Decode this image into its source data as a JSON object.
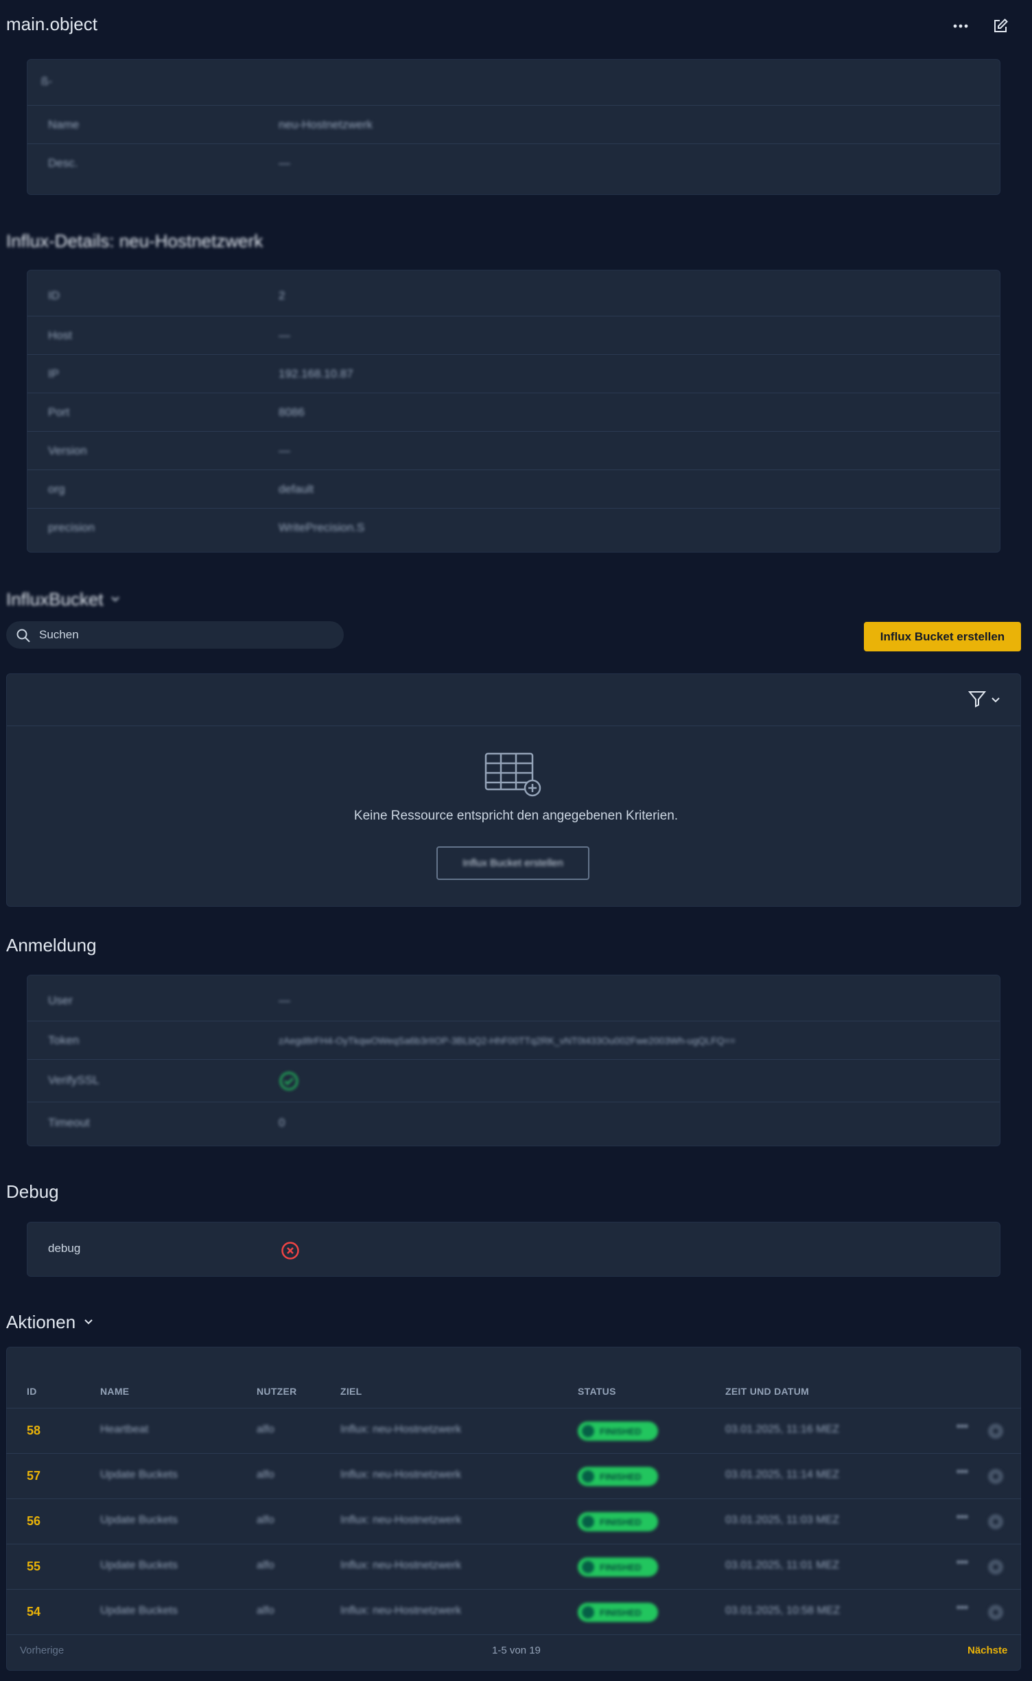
{
  "header": {
    "title": "main.object"
  },
  "info": {
    "title": "ß-",
    "rows": [
      {
        "label": "Name",
        "value": "neu-Hostnetzwerk"
      },
      {
        "label": "Desc.",
        "value": "—"
      }
    ]
  },
  "details": {
    "heading": "Influx-Details: neu-Hostnetzwerk",
    "rows": [
      {
        "label": "ID",
        "value": "2"
      },
      {
        "label": "Host",
        "value": "—"
      },
      {
        "label": "IP",
        "value": "192.168.10.87"
      },
      {
        "label": "Port",
        "value": "8086"
      },
      {
        "label": "Version",
        "value": "—"
      },
      {
        "label": "org",
        "value": "default"
      },
      {
        "label": "precision",
        "value": "WritePrecision.S"
      }
    ]
  },
  "buckets": {
    "heading": "InfluxBucket",
    "search_placeholder": "Suchen",
    "create_label": "Influx Bucket erstellen",
    "empty_text": "Keine Ressource entspricht den angegebenen Kriterien.",
    "empty_button": "Influx Bucket erstellen"
  },
  "login": {
    "heading": "Anmeldung",
    "rows": [
      {
        "label": "User",
        "value": "—"
      },
      {
        "label": "Token",
        "value": "zAegd8rFH4-OyTkqwOWeqSa6b3rIIOP-3BLbQ2-HhF00TTq2RK_vNT0t433Ou002Fwe2003Wh-ugQLFQ=="
      },
      {
        "label": "VerifySSL",
        "value": ""
      },
      {
        "label": "Timeout",
        "value": "0"
      }
    ]
  },
  "debug": {
    "heading": "Debug",
    "label": "debug"
  },
  "actions": {
    "heading": "Aktionen",
    "columns": [
      "ID",
      "NAME",
      "NUTZER",
      "ZIEL",
      "STATUS",
      "ZEIT UND DATUM"
    ],
    "rows": [
      {
        "id": "58",
        "name": "Heartbeat",
        "user": "alfo",
        "target": "Influx: neu-Hostnetzwerk",
        "status": "FINISHED",
        "time": "03.01.2025, 11:16 MEZ"
      },
      {
        "id": "57",
        "name": "Update Buckets",
        "user": "alfo",
        "target": "Influx: neu-Hostnetzwerk",
        "status": "FINISHED",
        "time": "03.01.2025, 11:14 MEZ"
      },
      {
        "id": "56",
        "name": "Update Buckets",
        "user": "alfo",
        "target": "Influx: neu-Hostnetzwerk",
        "status": "FINISHED",
        "time": "03.01.2025, 11:03 MEZ"
      },
      {
        "id": "55",
        "name": "Update Buckets",
        "user": "alfo",
        "target": "Influx: neu-Hostnetzwerk",
        "status": "FINISHED",
        "time": "03.01.2025, 11:01 MEZ"
      },
      {
        "id": "54",
        "name": "Update Buckets",
        "user": "alfo",
        "target": "Influx: neu-Hostnetzwerk",
        "status": "FINISHED",
        "time": "03.01.2025, 10:58 MEZ"
      }
    ],
    "pager": {
      "prev": "Vorherige",
      "range": "1-5 von 19",
      "next": "Nächste"
    }
  },
  "colors": {
    "background": "#0f172a",
    "panel": "#1e293b",
    "accent": "#eab308",
    "success": "#22c55e",
    "danger": "#ef4444"
  },
  "icons": [
    "more-horizontal-icon",
    "edit-icon",
    "search-icon",
    "filter-icon",
    "chevron-down-icon",
    "table-add-icon",
    "check-circle-icon",
    "x-circle-icon",
    "settings-icon"
  ]
}
